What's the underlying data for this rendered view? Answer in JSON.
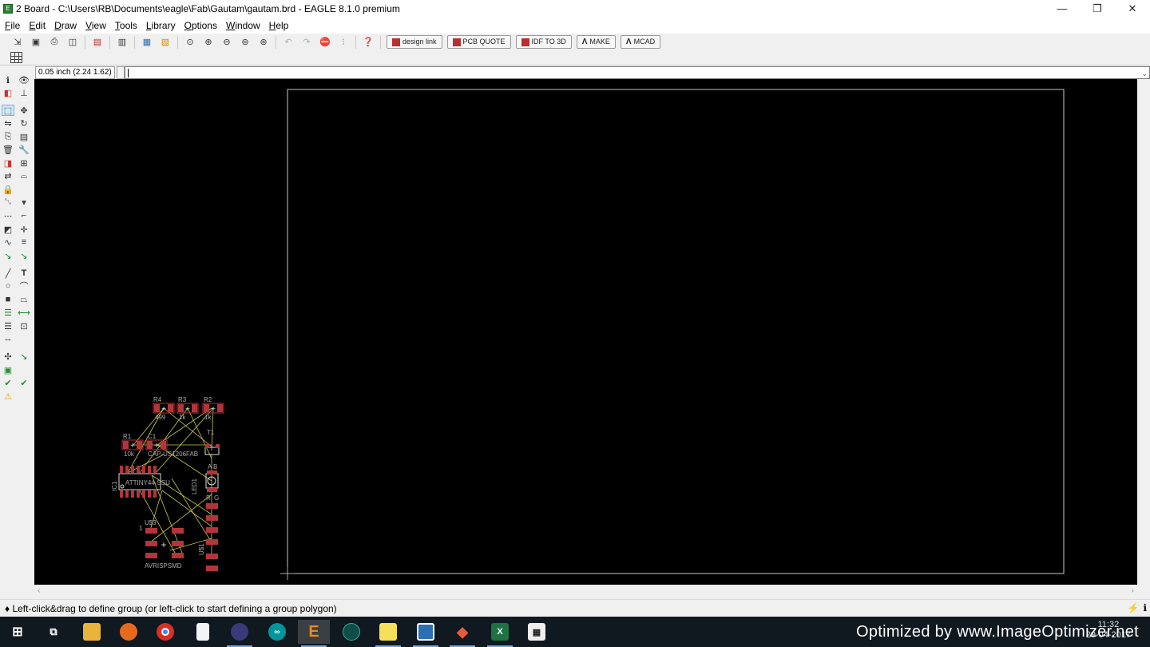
{
  "window": {
    "title": "2 Board - C:\\Users\\RB\\Documents\\eagle\\Fab\\Gautam\\gautam.brd - EAGLE 8.1.0 premium",
    "minimize": "—",
    "maximize": "❐",
    "close": "✕"
  },
  "menu": [
    {
      "first": "F",
      "rest": "ile"
    },
    {
      "first": "E",
      "rest": "dit"
    },
    {
      "first": "D",
      "rest": "raw"
    },
    {
      "first": "V",
      "rest": "iew"
    },
    {
      "first": "T",
      "rest": "ools"
    },
    {
      "first": "L",
      "rest": "ibrary"
    },
    {
      "first": "O",
      "rest": "ptions"
    },
    {
      "first": "W",
      "rest": "indow"
    },
    {
      "first": "H",
      "rest": "elp"
    }
  ],
  "toolbar": {
    "badges": {
      "design_link": "design link",
      "pcb_quote": "PCB QUOTE",
      "idf_3d": "IDF TO 3D",
      "make": "MAKE",
      "mcad": "MCAD"
    }
  },
  "coordinate": "0.05 inch (2.24 1.62)",
  "command_line": "",
  "status": "♦ Left-click&drag to define group (or left-click to start defining a group polygon)",
  "board": {
    "parts": {
      "r4": {
        "name": "R4",
        "value": "499"
      },
      "r3": {
        "name": "R3",
        "value": "1k"
      },
      "r2": {
        "name": "R2",
        "value": "1k"
      },
      "r1": {
        "name": "R1",
        "value": "10k"
      },
      "c1": {
        "name": "C1",
        "value": "CAP-US1206FAB"
      },
      "t1": {
        "name": "T1"
      },
      "ic1": {
        "name": "IC1",
        "value": "ATTINY44-SSU"
      },
      "led1": {
        "name": "LED1",
        "pin_a": "A",
        "pin_b": "B",
        "pin_r": "R",
        "pin_g": "G"
      },
      "u3": {
        "name": "U$3",
        "pin1": "1",
        "value": "AVRISPSMD"
      },
      "u1": {
        "name": "U$1"
      }
    }
  },
  "taskbar": {
    "time": "11:32",
    "date": "29-04-2017",
    "watermark": "Optimized by www.ImageOptimizer.net"
  },
  "colors": {
    "canvas": "#000000",
    "pad": "#b3343a",
    "airwire": "#c8c84a",
    "board_outline": "#c8c8c8"
  }
}
